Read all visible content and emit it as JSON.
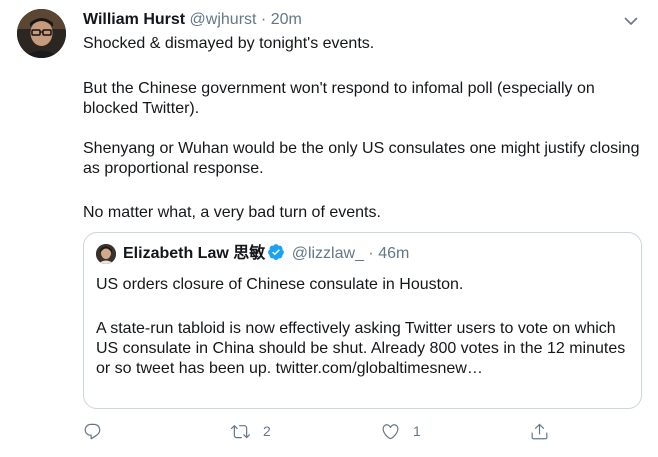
{
  "tweet": {
    "author_name": "William Hurst",
    "author_handle": "@wjhurst",
    "separator": "·",
    "time": "20m",
    "paragraphs": [
      "Shocked & dismayed by tonight's events.",
      "But the Chinese government won't respond to infomal poll (especially on blocked Twitter).",
      "Shenyang or Wuhan would be the only US consulates one might justify closing as proportional response.",
      "No matter what, a very bad turn of events."
    ]
  },
  "quote": {
    "author_name": "Elizabeth Law 思敏",
    "author_handle": "@lizzlaw_",
    "separator": "·",
    "time": "46m",
    "paragraphs": [
      "US orders closure of Chinese consulate in Houston.",
      "A state-run tabloid is now effectively asking Twitter users to vote on which US consulate in China should be shut. Already 800 votes in the 12 minutes or so tweet has been up. twitter.com/globaltimesnew…"
    ]
  },
  "actions": {
    "reply_count": "",
    "retweet_count": "2",
    "like_count": "1"
  },
  "icons": {
    "caret": "chevron-down-icon",
    "verified": "verified-badge-icon",
    "reply": "reply-icon",
    "retweet": "retweet-icon",
    "like": "heart-icon",
    "share": "share-icon"
  },
  "colors": {
    "text": "#14171a",
    "secondary": "#657786",
    "border": "#ccd6dd",
    "verified": "#1da1f2"
  }
}
